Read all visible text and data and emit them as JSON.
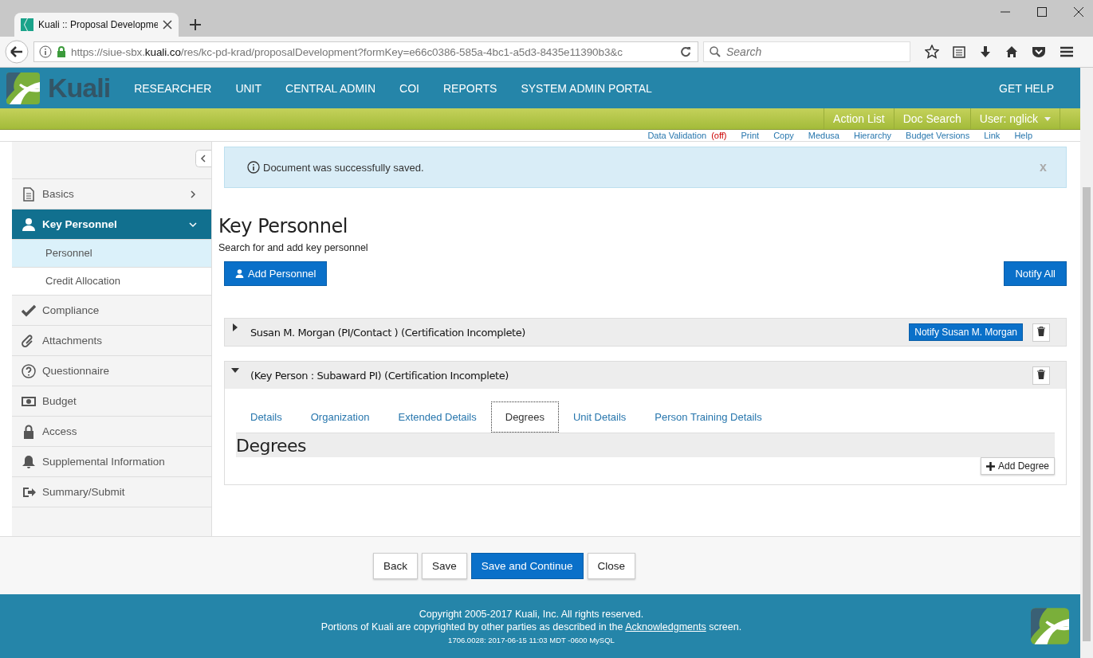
{
  "browser": {
    "tab_title": "Kuali :: Proposal Developme",
    "url_prefix": "https://siue-sbx.",
    "url_domain": "kuali.co",
    "url_rest": "/res/kc-pd-krad/proposalDevelopment?formKey=e66c0386-585a-4bc1-a5d3-8435e11390b3&c",
    "search_placeholder": "Search"
  },
  "header": {
    "logo_text": "Kuali",
    "nav": [
      "RESEARCHER",
      "UNIT",
      "CENTRAL ADMIN",
      "COI",
      "REPORTS",
      "SYSTEM ADMIN PORTAL"
    ],
    "help": "GET HELP"
  },
  "user_bar": [
    "Action List",
    "Doc Search",
    "User: nglick"
  ],
  "doc_toolbar": [
    {
      "label": "Data Validation",
      "note": "(off)"
    },
    {
      "label": "Print"
    },
    {
      "label": "Copy"
    },
    {
      "label": "Medusa"
    },
    {
      "label": "Hierarchy"
    },
    {
      "label": "Budget Versions"
    },
    {
      "label": "Link"
    },
    {
      "label": "Help"
    }
  ],
  "sidebar": {
    "items": [
      {
        "label": "Basics",
        "selected": false,
        "expanded": false
      },
      {
        "label": "Key Personnel",
        "selected": true,
        "expanded": true,
        "children": [
          {
            "label": "Personnel",
            "selected": true
          },
          {
            "label": "Credit Allocation",
            "selected": false
          }
        ]
      },
      {
        "label": "Compliance",
        "selected": false
      },
      {
        "label": "Attachments",
        "selected": false
      },
      {
        "label": "Questionnaire",
        "selected": false
      },
      {
        "label": "Budget",
        "selected": false
      },
      {
        "label": "Access",
        "selected": false
      },
      {
        "label": "Supplemental Information",
        "selected": false
      },
      {
        "label": "Summary/Submit",
        "selected": false
      }
    ]
  },
  "alert": {
    "message": "Document was successfully saved.",
    "close": "x"
  },
  "page": {
    "title": "Key Personnel",
    "subtitle": "Search for and add key personnel",
    "add_button": "Add Personnel",
    "notify_all": "Notify All"
  },
  "persons": [
    {
      "title": "Susan M. Morgan (PI/Contact ) (Certification Incomplete)",
      "expanded": false,
      "notify_button": "Notify Susan M. Morgan"
    },
    {
      "title": "(Key Person : Subaward PI) (Certification Incomplete)",
      "expanded": true,
      "tabs": [
        {
          "label": "Details",
          "selected": false
        },
        {
          "label": "Organization",
          "selected": false
        },
        {
          "label": "Extended Details",
          "selected": false
        },
        {
          "label": "Degrees",
          "selected": true
        },
        {
          "label": "Unit Details",
          "selected": false
        },
        {
          "label": "Person Training Details",
          "selected": false
        }
      ],
      "section_title": "Degrees",
      "add_button": "Add Degree"
    }
  ],
  "buttons": [
    {
      "label": "Back",
      "kind": "plain"
    },
    {
      "label": "Save",
      "kind": "plain"
    },
    {
      "label": "Save and Continue",
      "kind": "primary"
    },
    {
      "label": "Close",
      "kind": "plain"
    }
  ],
  "footer": {
    "copyright": "Copyright 2005-2017 Kuali, Inc. All rights reserved.",
    "portions_before": "Portions of Kuali are copyrighted by other parties as described in the",
    "link": "Acknowledgments",
    "portions_after": "screen.",
    "version": "1706.0028: 2017-06-15 11:03 MDT -0600 MySQL"
  }
}
